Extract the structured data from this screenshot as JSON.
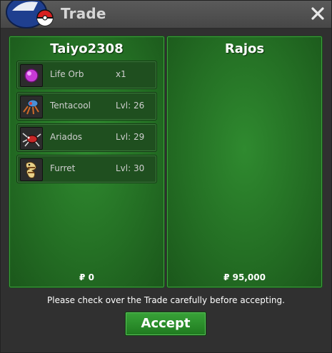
{
  "window": {
    "title": "Trade"
  },
  "left_panel": {
    "player_name": "Taiyo2308",
    "money": "₽ 0",
    "items": [
      {
        "name": "Life Orb",
        "detail": "x1",
        "icon": "life-orb-icon"
      },
      {
        "name": "Tentacool",
        "detail": "Lvl: 26",
        "icon": "tentacool-icon"
      },
      {
        "name": "Ariados",
        "detail": "Lvl: 29",
        "icon": "ariados-icon"
      },
      {
        "name": "Furret",
        "detail": "Lvl: 30",
        "icon": "furret-icon"
      }
    ]
  },
  "right_panel": {
    "player_name": "Rajos",
    "money": "₽ 95,000",
    "items": []
  },
  "footer": {
    "notice": "Please check over the Trade carefully before accepting.",
    "accept_label": "Accept"
  },
  "colors": {
    "panel_green": "#2f8a2f",
    "accept_green": "#2e8f2e",
    "titlebar": "#4f4f4f"
  }
}
